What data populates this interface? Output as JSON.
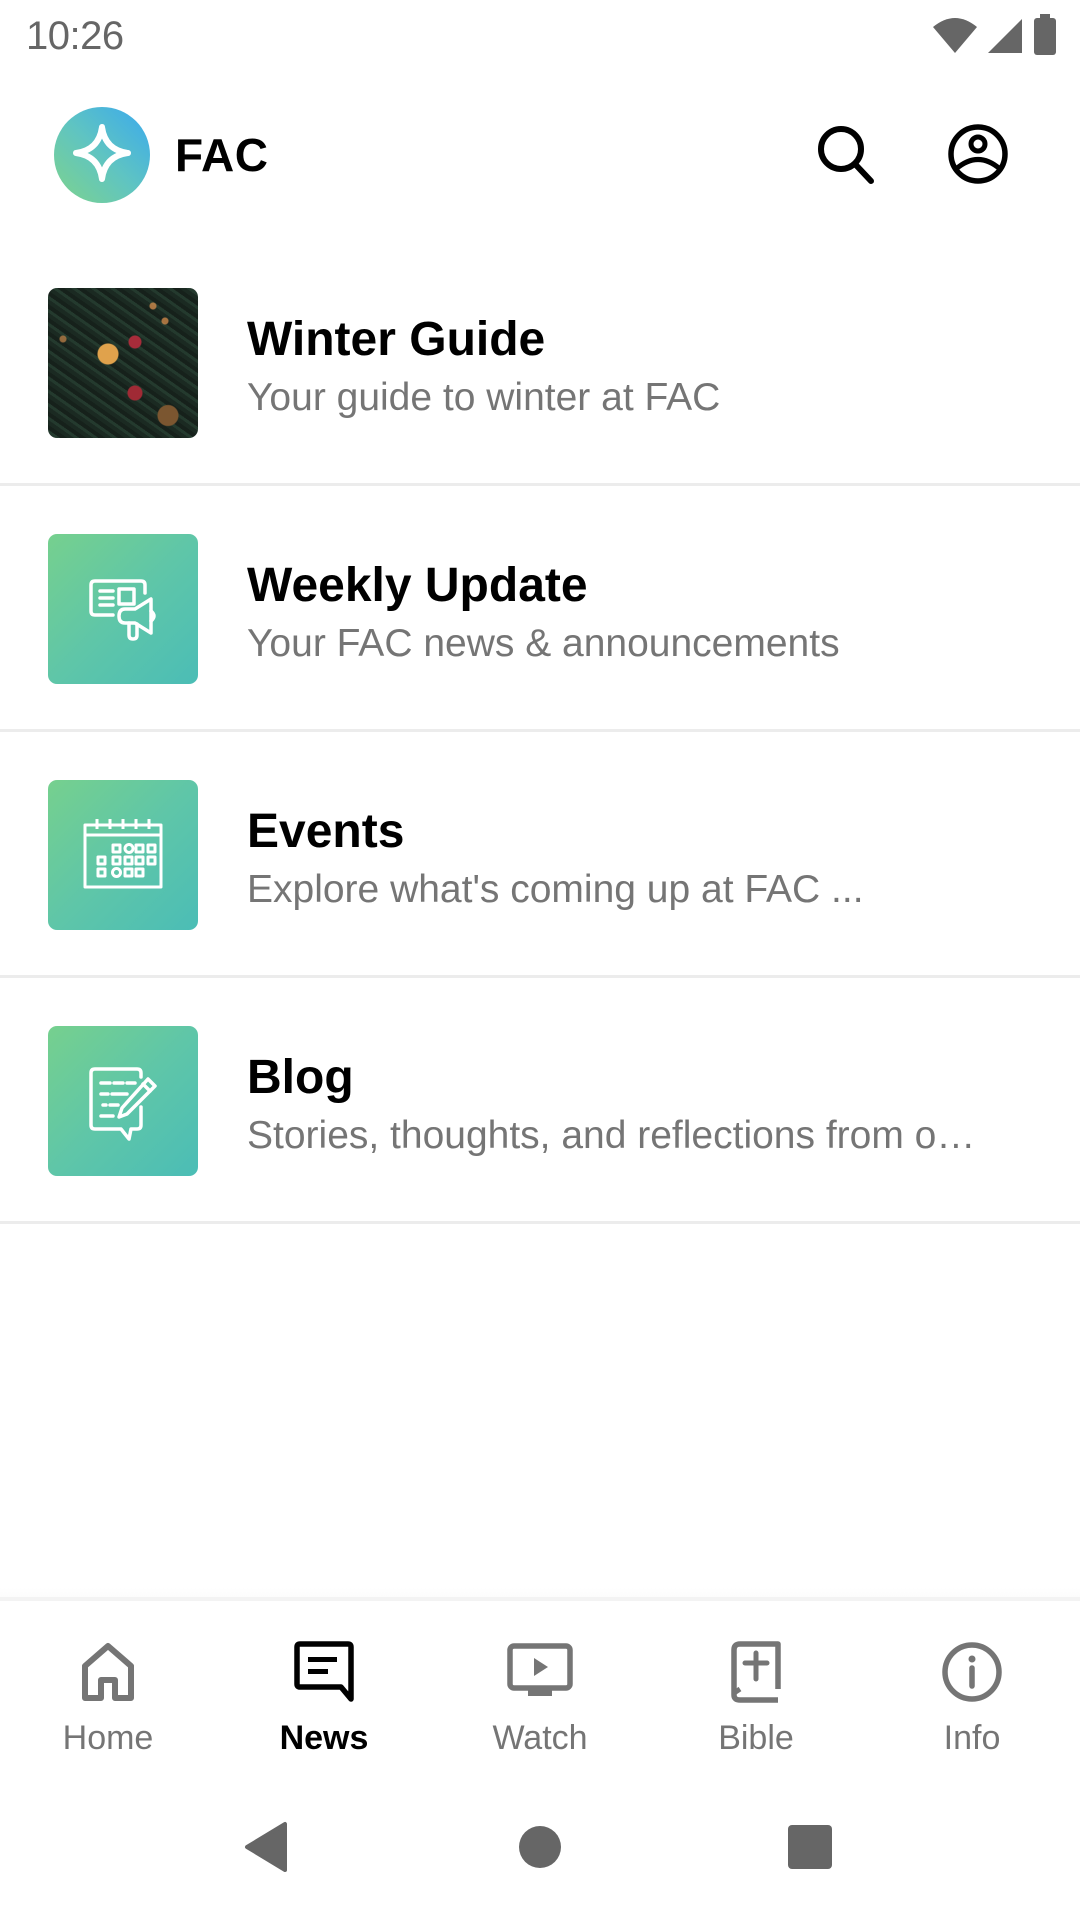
{
  "status_bar": {
    "time": "10:26",
    "icons": [
      "wifi-icon",
      "cell-signal-icon",
      "battery-icon"
    ]
  },
  "app_bar": {
    "title": "FAC",
    "logo_icon": "sparkle-star-icon",
    "actions": [
      {
        "icon": "search-icon",
        "label": "Search"
      },
      {
        "icon": "account-circle-icon",
        "label": "Profile"
      }
    ]
  },
  "list": {
    "items": [
      {
        "title": "Winter Guide",
        "subtitle": "Your guide to winter at FAC",
        "thumbnail": "winter-pine-photo"
      },
      {
        "title": "Weekly Update",
        "subtitle": "Your FAC news & announcements",
        "thumbnail": "megaphone-announcement-icon"
      },
      {
        "title": "Events",
        "subtitle": "Explore what's coming up at FAC ...",
        "thumbnail": "calendar-icon"
      },
      {
        "title": "Blog",
        "subtitle": "Stories, thoughts, and reflections from o…",
        "thumbnail": "blog-edit-icon"
      }
    ]
  },
  "bottom_nav": {
    "active": "News",
    "items": [
      {
        "label": "Home",
        "icon": "home-icon"
      },
      {
        "label": "News",
        "icon": "news-message-icon"
      },
      {
        "label": "Watch",
        "icon": "tv-play-icon"
      },
      {
        "label": "Bible",
        "icon": "bible-icon"
      },
      {
        "label": "Info",
        "icon": "info-icon"
      }
    ]
  },
  "system_nav": {
    "buttons": [
      "back",
      "home",
      "recents"
    ]
  },
  "colors": {
    "accent_gradient_start": "#76d08e",
    "accent_gradient_end": "#4bbdb6",
    "logo_blue": "#3aa9ee",
    "subtitle_gray": "#757575",
    "inactive_nav": "#757575",
    "active_nav": "#000000",
    "divider": "#ececec"
  }
}
